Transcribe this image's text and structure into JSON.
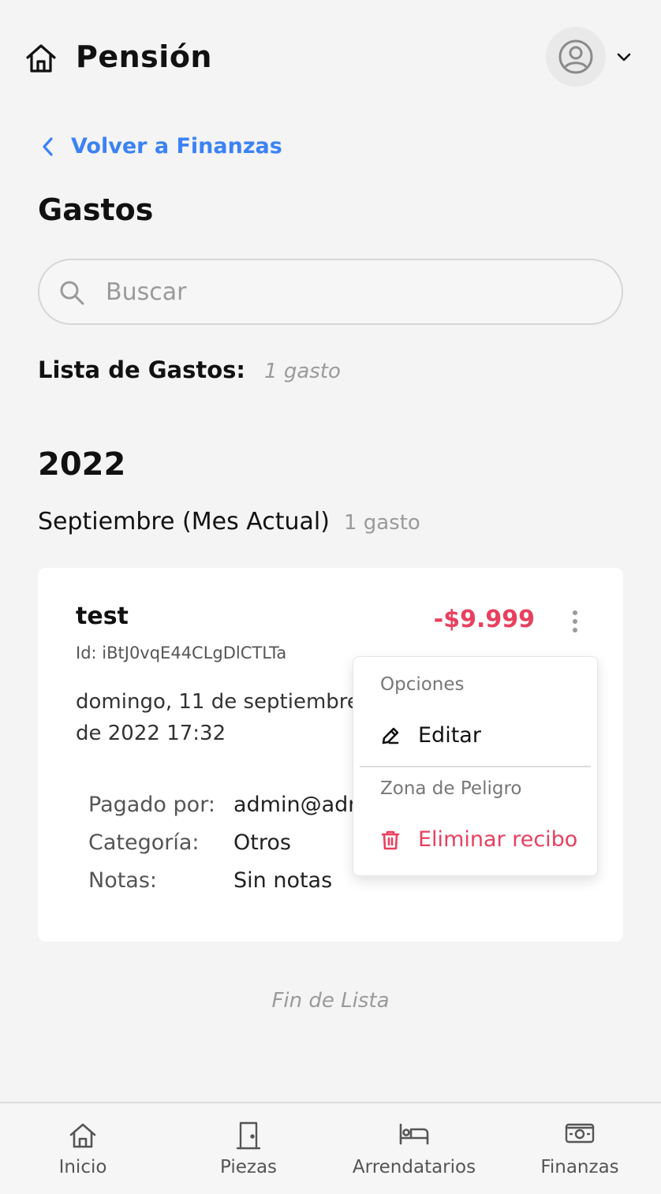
{
  "header": {
    "title": "Pensión",
    "icons": {
      "home": "home-icon",
      "user": "user-circle-icon",
      "chevron": "chevron-down-icon"
    }
  },
  "back_link": {
    "label": "Volver a Finanzas"
  },
  "page_title": "Gastos",
  "search": {
    "placeholder": "Buscar",
    "value": ""
  },
  "list": {
    "label": "Lista de Gastos:",
    "count": "1 gasto"
  },
  "groups": [
    {
      "year": "2022",
      "month": "Septiembre (Mes Actual)",
      "month_count": "1 gasto",
      "expenses": [
        {
          "name": "test",
          "id": "Id: iBtJ0vqE44CLgDlCTLTa",
          "amount": "-$9.999",
          "date": "domingo, 11 de septiembre de 2022 17:32",
          "paid_by_label": "Pagado por:",
          "paid_by": "admin@adr",
          "category_label": "Categoría:",
          "category": "Otros",
          "notes_label": "Notas:",
          "notes": "Sin notas"
        }
      ]
    }
  ],
  "context_menu": {
    "section_options": "Opciones",
    "edit": "Editar",
    "section_danger": "Zona de Peligro",
    "delete": "Eliminar recibo"
  },
  "end_of_list": "Fin de Lista",
  "bottom_nav": [
    {
      "label": "Inicio",
      "icon": "home-icon"
    },
    {
      "label": "Piezas",
      "icon": "door-icon"
    },
    {
      "label": "Arrendatarios",
      "icon": "bed-icon"
    },
    {
      "label": "Finanzas",
      "icon": "cash-icon"
    }
  ],
  "colors": {
    "accent": "#3b82f6",
    "danger": "#e8405f",
    "background": "#f4f4f4"
  }
}
